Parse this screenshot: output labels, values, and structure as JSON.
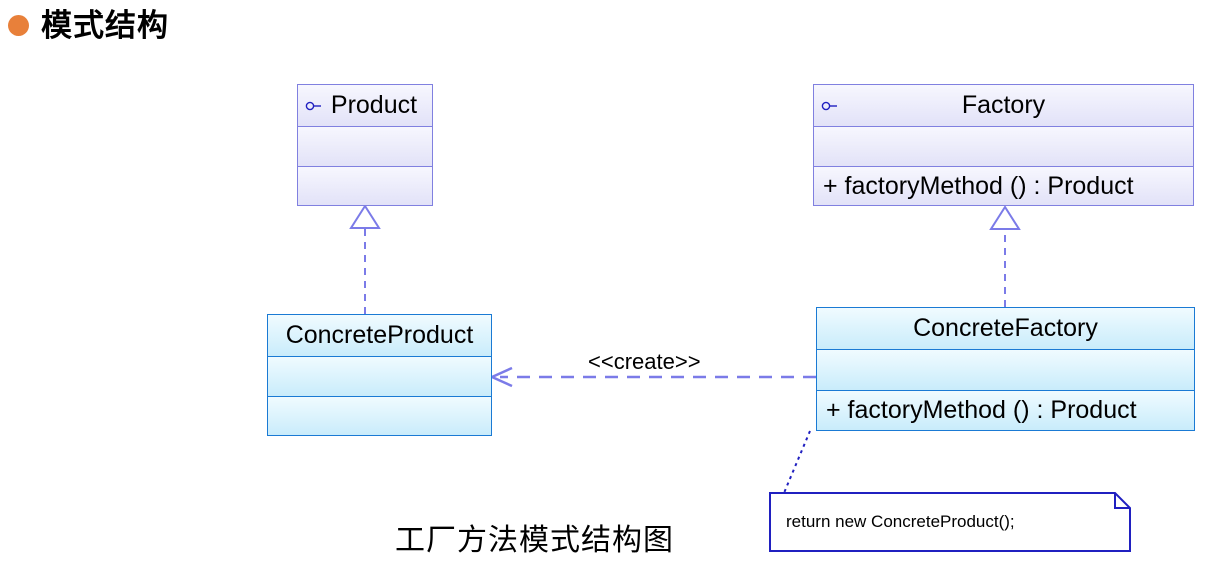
{
  "slide": {
    "heading": "模式结构",
    "bullet_color": "#e8803a",
    "caption": "工厂方法模式结构图"
  },
  "diagram": {
    "type": "uml-class-diagram",
    "colors": {
      "abstract_fill_top": "#f7f7fe",
      "abstract_fill_bottom": "#e2e2f8",
      "abstract_border": "#8080e0",
      "concrete_fill_top": "#f0fbff",
      "concrete_fill_bottom": "#c9ecfb",
      "concrete_border": "#1a7ad4",
      "connector": "#7b7be8",
      "note_border": "#2020c0"
    },
    "classes": [
      {
        "id": "product",
        "name": "Product",
        "stereotype_icon": "interface-lollipop-icon",
        "style": "lavender",
        "attributes": [],
        "operations": []
      },
      {
        "id": "factory",
        "name": "Factory",
        "stereotype_icon": "interface-lollipop-icon",
        "style": "lavender",
        "attributes": [],
        "operations": [
          "+ factoryMethod () : Product"
        ]
      },
      {
        "id": "concrete-product",
        "name": "ConcreteProduct",
        "style": "cyan",
        "attributes": [],
        "operations": []
      },
      {
        "id": "concrete-factory",
        "name": "ConcreteFactory",
        "style": "cyan",
        "attributes": [],
        "operations": [
          "+ factoryMethod () : Product"
        ]
      }
    ],
    "relations": [
      {
        "id": "product-realization",
        "from": "concrete-product",
        "to": "product",
        "kind": "realization",
        "label": ""
      },
      {
        "id": "factory-realization",
        "from": "concrete-factory",
        "to": "factory",
        "kind": "realization",
        "label": ""
      },
      {
        "id": "create-dependency",
        "from": "concrete-factory",
        "to": "concrete-product",
        "kind": "dependency",
        "label": "<<create>>"
      },
      {
        "id": "note-anchor",
        "from": "concrete-factory",
        "to": "note",
        "kind": "note-link",
        "label": ""
      }
    ],
    "note": {
      "id": "note",
      "text": "return new ConcreteProduct();"
    }
  }
}
